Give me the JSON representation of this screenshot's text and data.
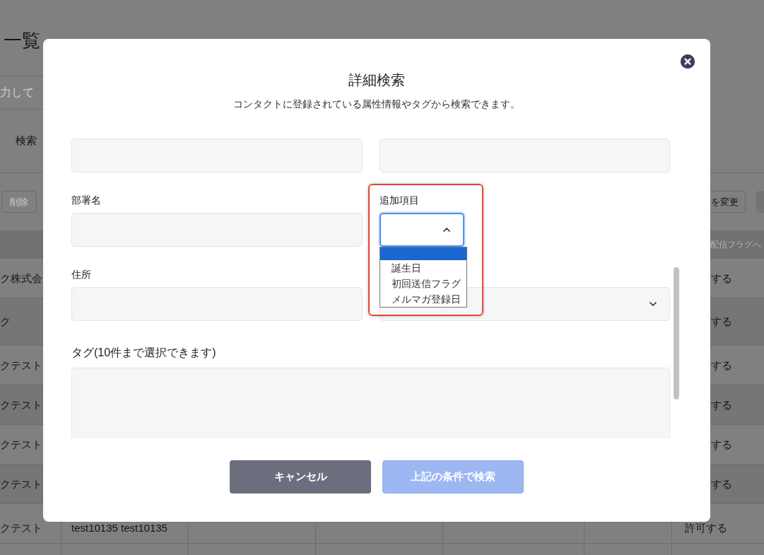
{
  "background": {
    "page_title": "一覧",
    "search_field": {
      "placeholder": "力して"
    },
    "section_label": "検索",
    "toolbar": {
      "left_buttons": [
        {
          "label": "削除",
          "disabled": true
        }
      ],
      "right_buttons": [
        {
          "label": "を変更"
        }
      ]
    },
    "table": {
      "header": {
        "column_last": "配信フラグへ"
      },
      "rows": [
        {
          "column_1": "ク株式会",
          "column_last": "する"
        },
        {
          "column_1": "ク",
          "column_last": "する"
        },
        {
          "column_1": "クテスト",
          "column_last": "する"
        },
        {
          "column_1": "クテスト",
          "column_last": "する"
        },
        {
          "column_1": "クテスト",
          "column_last": "する"
        },
        {
          "column_1": "クテスト",
          "column_last": "する"
        },
        {
          "column_1": "クテスト",
          "column_2": "test10135 test10135",
          "column_last": "許可する"
        }
      ]
    }
  },
  "dialog": {
    "title": "詳細検索",
    "subtitle": "コンタクトに登録されている属性情報やタグから検索できます。",
    "fields": [
      {
        "kind": "input"
      },
      {
        "kind": "input"
      },
      {
        "kind": "input",
        "label": "部署名"
      },
      {
        "kind": "select",
        "label": "追加項目",
        "focused": true,
        "expanded": true,
        "highlighted": true,
        "options": [
          {
            "selected": true
          },
          {
            "label": "誕生日",
            "selected": false
          },
          {
            "label": "初回送信フラグ",
            "selected": false
          },
          {
            "label": "メルマガ登録日",
            "selected": false
          }
        ]
      },
      {
        "kind": "input",
        "label": "住所"
      },
      {
        "kind": "select",
        "focused": false,
        "expanded": false
      },
      {
        "kind": "textarea",
        "label": "タグ(10件まで選択できます)"
      }
    ],
    "buttons": [
      {
        "label": "キャンセル",
        "kind": "secondary",
        "disabled": false
      },
      {
        "label": "上記の条件で検索",
        "kind": "primary",
        "disabled": true
      }
    ]
  }
}
